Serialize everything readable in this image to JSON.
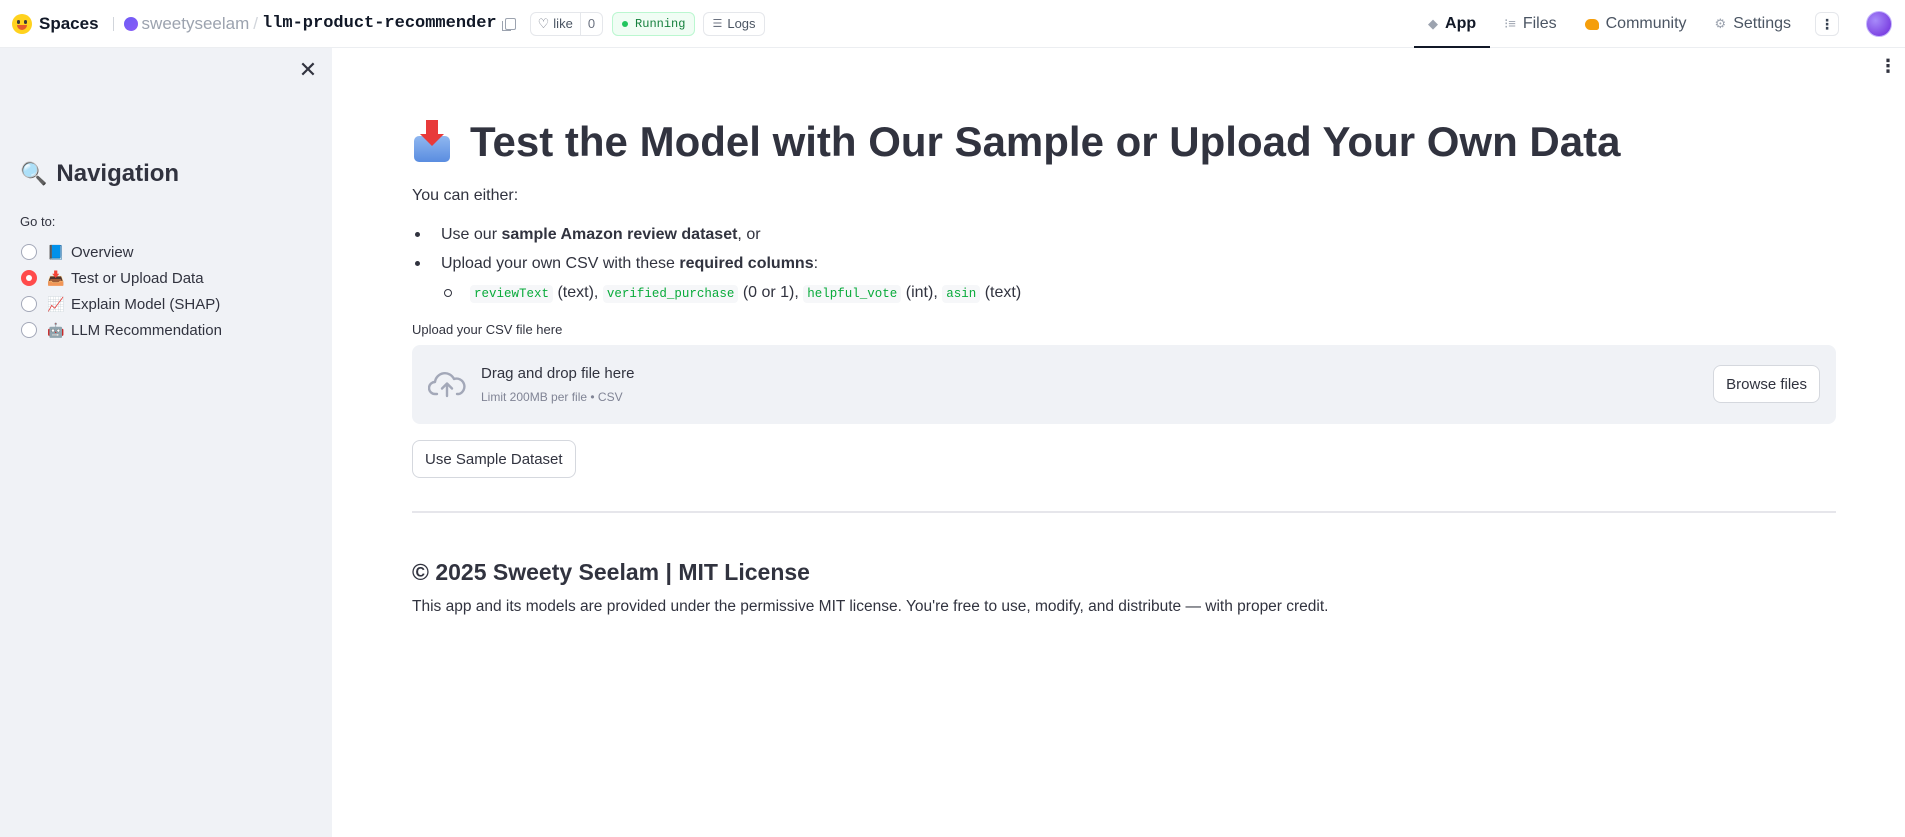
{
  "topbar": {
    "spaces_label": "Spaces",
    "owner": "sweetyseelam",
    "slash": "/",
    "repo": "llm-product-recommender",
    "like_label": "like",
    "like_count": "0",
    "status": "Running",
    "logs_label": "Logs",
    "tabs": [
      {
        "label": "App",
        "icon": "cube-icon"
      },
      {
        "label": "Files",
        "icon": "files-icon"
      },
      {
        "label": "Community",
        "icon": "community-icon"
      },
      {
        "label": "Settings",
        "icon": "gear-icon"
      }
    ]
  },
  "sidebar": {
    "close_glyph": "✕",
    "title_emoji": "🔍",
    "title": "Navigation",
    "goto_label": "Go to:",
    "items": [
      {
        "emoji": "📘",
        "label": "Overview",
        "selected": false
      },
      {
        "emoji": "📥",
        "label": "Test or Upload Data",
        "selected": true
      },
      {
        "emoji": "📈",
        "label": "Explain Model (SHAP)",
        "selected": false
      },
      {
        "emoji": "🤖",
        "label": "LLM Recommendation",
        "selected": false
      }
    ]
  },
  "main": {
    "title": "Test the Model with Our Sample or Upload Your Own Data",
    "intro": "You can either:",
    "bullet1_pre": "Use our ",
    "bullet1_bold": "sample Amazon review dataset",
    "bullet1_post": ", or",
    "bullet2_pre": "Upload your own CSV with these ",
    "bullet2_bold": "required columns",
    "bullet2_post": ":",
    "columns": [
      {
        "name": "reviewText",
        "type": "(text)",
        "sep": ","
      },
      {
        "name": "verified_purchase",
        "type": "(0 or 1)",
        "sep": ","
      },
      {
        "name": "helpful_vote",
        "type": "(int)",
        "sep": ","
      },
      {
        "name": "asin",
        "type": "(text)",
        "sep": ""
      }
    ],
    "upload_label": "Upload your CSV file here",
    "drop_title": "Drag and drop file here",
    "drop_limit": "Limit 200MB per file • CSV",
    "browse_label": "Browse files",
    "sample_button": "Use Sample Dataset",
    "footer_title": "© 2025 Sweety Seelam | MIT License",
    "footer_text": "This app and its models are provided under the permissive MIT license. You're free to use, modify, and distribute — with proper credit."
  },
  "colors": {
    "accent": "#ff4b4b",
    "code_text": "#09ab3b",
    "sidebar_bg": "#f0f2f6",
    "status_green": "#22c55e"
  }
}
